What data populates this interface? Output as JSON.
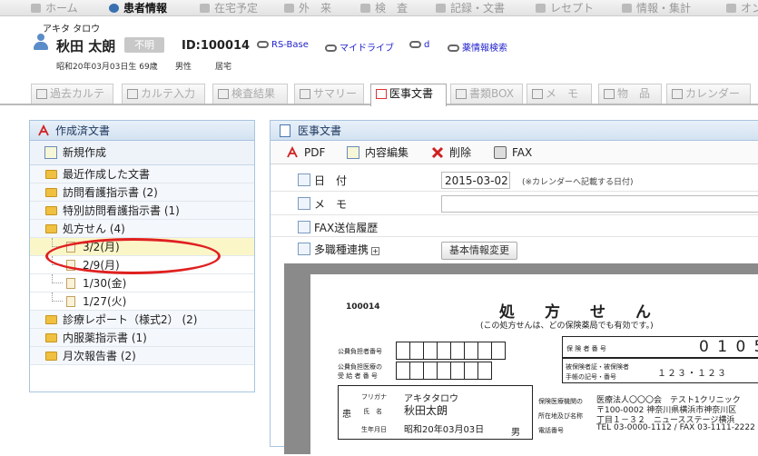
{
  "topnav": {
    "items": [
      "ホーム",
      "患者情報",
      "在宅予定",
      "外　来",
      "検　査",
      "記録・文書",
      "レセプト",
      "情報・集計",
      "オン"
    ]
  },
  "patient": {
    "kana": "アキタ タロウ",
    "name": "秋田 太朗",
    "fumei": "不明",
    "id": "ID:100014",
    "links": [
      "RS-Base",
      "マイドライブ",
      "d",
      "薬情報検索"
    ],
    "birth": "昭和20年03月03日生 69歳",
    "sex": "男性",
    "status": "居宅"
  },
  "tabs": [
    "過去カルテ",
    "カルテ入力",
    "検査結果",
    "サマリー",
    "医事文書",
    "書類BOX",
    "メ　モ",
    "物　品",
    "カレンダー"
  ],
  "left_panel": {
    "title": "作成済文書",
    "new_button": "新規作成",
    "items": [
      {
        "label": "最近作成した文書"
      },
      {
        "label": "訪問看護指示書 (2)"
      },
      {
        "label": "特別訪問看護指示書 (1)"
      },
      {
        "label": "処方せん (4)"
      },
      {
        "label": "3/2(月)"
      },
      {
        "label": "2/9(月)"
      },
      {
        "label": "1/30(金)"
      },
      {
        "label": "1/27(火)"
      },
      {
        "label": "診療レポート（様式2） (2)"
      },
      {
        "label": "内服薬指示書 (1)"
      },
      {
        "label": "月次報告書 (2)"
      }
    ]
  },
  "right_panel": {
    "title": "医事文書",
    "toolbar": {
      "pdf": "PDF",
      "edit": "内容編集",
      "delete": "削除",
      "fax": "FAX"
    },
    "date_label": "日　付",
    "date_value": "2015-03-02",
    "date_note": "(※カレンダーへ記載する日付)",
    "memo_label": "メ　モ",
    "memo_value": "",
    "fax_label": "FAX送信履歴",
    "multi_label": "多職種連携",
    "basic_button": "基本情報変更"
  },
  "document": {
    "patient_id": "100014",
    "title": "処　方　せ　ん",
    "subtitle": "(この処方せんは、どの保険薬局でも有効です。)",
    "public_payer": "公費負担者番号",
    "public_recipient_1": "公費負担医療の",
    "public_recipient_2": "受 給 者 番 号",
    "insurer_no": "保 険 者 番 号",
    "insured_card_1": "被保険者証・被保険者",
    "insured_card_2": "手帳の記号・番号",
    "insurer_digits": "0 1 0 5",
    "card_no": "１２３・１２３",
    "kanja": "患",
    "furigana_label": "フリガナ",
    "furigana": "アキタタロウ",
    "name_label": "氏　名",
    "name": "秋田太朗",
    "birth_label": "生年月日",
    "birth": "昭和20年03月03日",
    "male": "男",
    "inst_label_1": "保険医療機関の",
    "inst_label_2": "所在地及び名称",
    "inst_label_3": "電話番号",
    "inst_name": "医療法人〇〇〇会　テスト1クリニック",
    "inst_addr": "〒100-0002 神奈川県横浜市神奈川区",
    "inst_addr2": "丁目１－３２　ニュースステージ横浜",
    "inst_tel": "TEL 03-0000-1112 / FAX 03-1111-2222"
  }
}
